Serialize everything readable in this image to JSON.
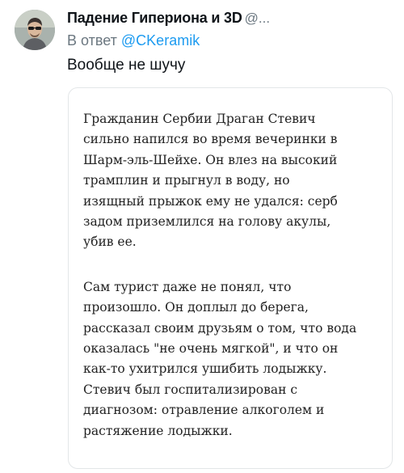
{
  "tweet": {
    "author": {
      "name": "Падение Гипериона и 3D",
      "handle": "@..."
    },
    "reply": {
      "prefix": "В ответ",
      "mention": "@CKeramik"
    },
    "text": "Вообще не шучу",
    "media": {
      "paragraphs": [
        {
          "lines": [
            "Гражданин Сербии Драган Стевич",
            "сильно напился во время вечеринки в",
            "Шарм-эль-Шейхе. Он влез на высокий",
            "трамплин и прыгнул в воду, но",
            "изящный прыжок ему не удался: серб",
            "задом приземлился на голову акулы,",
            "убив ее."
          ]
        },
        {
          "lines": [
            "Сам турист даже не понял, что",
            "произошло. Он доплыл до берега,",
            "рассказал своим друзьям о том, что вода",
            "оказалась \"не очень мягкой\", и что он",
            "как-то ухитрился ушибить лодыжку.",
            "Стевич был госпитализирован с",
            "диагнозом: отравление алкоголем и",
            "растяжение лодыжки."
          ]
        }
      ]
    }
  },
  "colors": {
    "link": "#1d9bf0",
    "secondary_text": "#6b7780",
    "primary_text": "#0f1419"
  }
}
